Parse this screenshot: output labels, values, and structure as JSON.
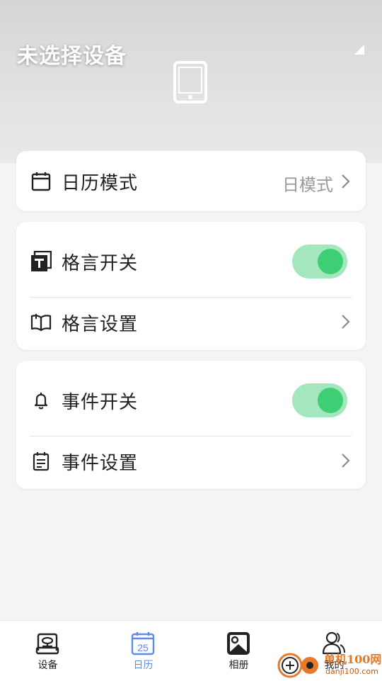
{
  "header": {
    "device_title": "未选择设备"
  },
  "calendar_card": {
    "mode_label": "日历模式",
    "mode_value": "日模式"
  },
  "motto_card": {
    "switch_label": "格言开关",
    "switch_on": true,
    "settings_label": "格言设置"
  },
  "event_card": {
    "switch_label": "事件开关",
    "switch_on": true,
    "settings_label": "事件设置"
  },
  "tabbar": {
    "items": [
      {
        "label": "设备",
        "icon": "device-icon",
        "active": false
      },
      {
        "label": "日历",
        "icon": "calendar-icon",
        "active": true,
        "icon_text": "25"
      },
      {
        "label": "相册",
        "icon": "album-icon",
        "active": false
      },
      {
        "label": "我的",
        "icon": "user-icon",
        "active": false
      }
    ]
  },
  "watermark": {
    "line1": "单机100网",
    "line2": "danji100.com"
  },
  "colors": {
    "toggle_track": "#a4e6bd",
    "toggle_knob": "#3ecf74",
    "tab_active": "#5b8de6"
  }
}
